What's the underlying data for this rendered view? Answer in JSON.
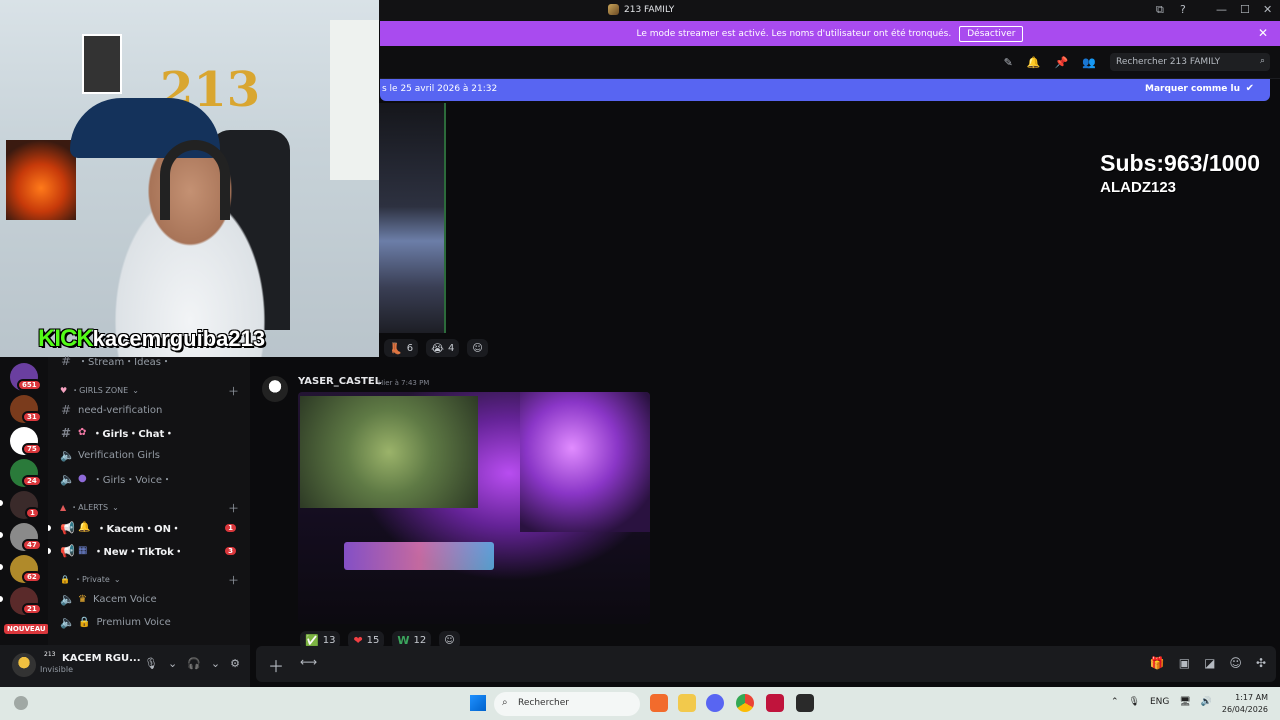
{
  "window": {
    "title": "213 FAMILY",
    "controls": [
      "⧉",
      "?",
      "—",
      "☐",
      "✕"
    ]
  },
  "banner": {
    "text": "Le mode streamer est activé. Les noms d'utilisateur ont été tronqués.",
    "button": "Désactiver",
    "close": "✕"
  },
  "header": {
    "search_placeholder": "Rechercher 213 FAMILY"
  },
  "new_messages": {
    "text": "s le 25 avril 2026 à 21:32",
    "action": "Marquer comme lu"
  },
  "overlay": {
    "subs": "Subs:963/1000",
    "channel": "ALADZ123",
    "kick_label": "KICK",
    "kick_user": "kacemrguiba213"
  },
  "reactions_top": [
    {
      "emoji": "👢",
      "count": "6"
    },
    {
      "emoji": "😭",
      "count": "4"
    }
  ],
  "message": {
    "author": "YASER_CASTEL",
    "time": "Hier à 7:43 PM",
    "reactions": [
      {
        "emoji": "✅",
        "count": "13"
      },
      {
        "emoji": "❤",
        "count": "15"
      },
      {
        "emoji": "W",
        "count": "12"
      }
    ]
  },
  "servers": [
    {
      "badge": "651",
      "color": "#6a3fa0"
    },
    {
      "badge": "31",
      "color": "#7a3b1c"
    },
    {
      "badge": "75",
      "color": "#ffffff"
    },
    {
      "badge": "24",
      "color": "#2a7a3a"
    },
    {
      "badge": "1",
      "color": "#3a2a2a"
    },
    {
      "badge": "47",
      "color": "#8a8a8a"
    },
    {
      "badge": "62",
      "color": "#b08a2a"
    },
    {
      "badge": "21",
      "color": "#5a2a2a"
    }
  ],
  "nouveau": "NOUVEAU",
  "channels": {
    "top_item": "・Stream・Ideas・",
    "cat_girls": "・GIRLS ZONE",
    "need_verification": "need-verification",
    "girls_chat": "・Girls・Chat・",
    "verification_girls": "Verification Girls",
    "girls_voice": "・Girls・Voice・",
    "cat_alerts": "・ALERTS",
    "kacem_on": "・Kacem・ON・",
    "kacem_on_badge": "1",
    "new_tiktok": "・New・TikTok・",
    "new_tiktok_badge": "3",
    "cat_private": "・Private",
    "kacem_voice": "Kacem Voice",
    "premium_voice": "Premium Voice"
  },
  "user": {
    "tag": "213",
    "name": "KACEM RGU...",
    "status": "Invisible"
  },
  "taskbar": {
    "search": "Rechercher",
    "lang": "ENG",
    "time": "1:17 AM",
    "date": "26/04/2026"
  }
}
